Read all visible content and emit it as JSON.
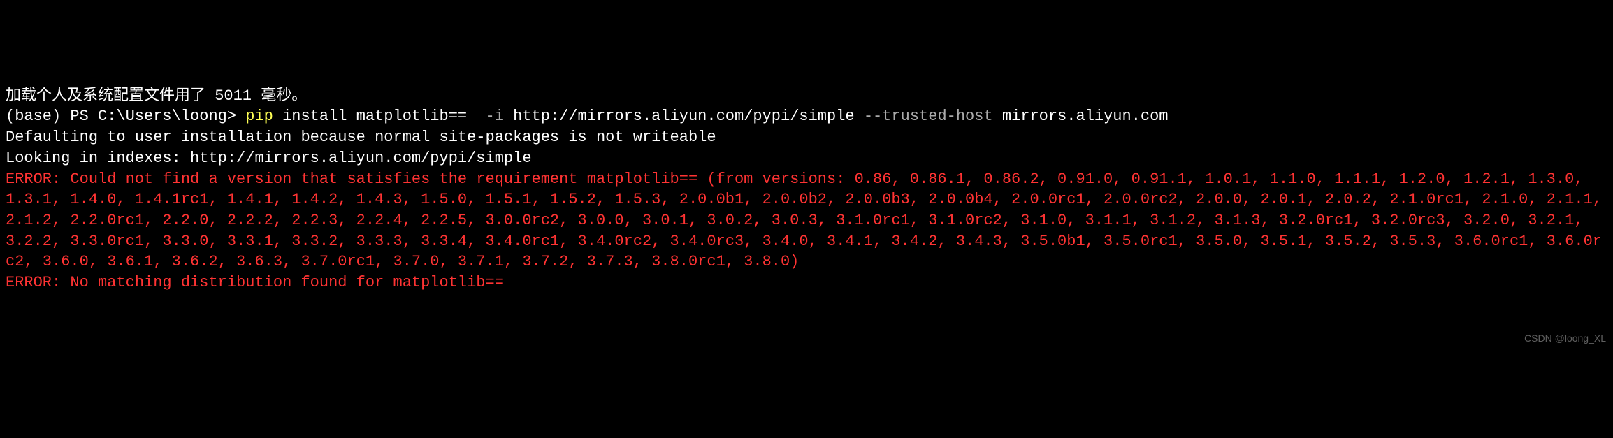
{
  "terminal": {
    "line1": "加载个人及系统配置文件用了 5011 毫秒。",
    "prompt_prefix": "(base) PS C:\\Users\\loong> ",
    "cmd_pip": "pip",
    "cmd_rest1": " install matplotlib==  ",
    "cmd_flag_i": "-i",
    "cmd_url": " http://mirrors.aliyun.com/pypi/simple ",
    "cmd_flag_th": "--trusted-host",
    "cmd_host": " mirrors.aliyun.com",
    "line_default": "Defaulting to user installation because normal site-packages is not writeable",
    "line_looking": "Looking in indexes: http://mirrors.aliyun.com/pypi/simple",
    "error_versions": "ERROR: Could not find a version that satisfies the requirement matplotlib== (from versions: 0.86, 0.86.1, 0.86.2, 0.91.0, 0.91.1, 1.0.1, 1.1.0, 1.1.1, 1.2.0, 1.2.1, 1.3.0, 1.3.1, 1.4.0, 1.4.1rc1, 1.4.1, 1.4.2, 1.4.3, 1.5.0, 1.5.1, 1.5.2, 1.5.3, 2.0.0b1, 2.0.0b2, 2.0.0b3, 2.0.0b4, 2.0.0rc1, 2.0.0rc2, 2.0.0, 2.0.1, 2.0.2, 2.1.0rc1, 2.1.0, 2.1.1, 2.1.2, 2.2.0rc1, 2.2.0, 2.2.2, 2.2.3, 2.2.4, 2.2.5, 3.0.0rc2, 3.0.0, 3.0.1, 3.0.2, 3.0.3, 3.1.0rc1, 3.1.0rc2, 3.1.0, 3.1.1, 3.1.2, 3.1.3, 3.2.0rc1, 3.2.0rc3, 3.2.0, 3.2.1, 3.2.2, 3.3.0rc1, 3.3.0, 3.3.1, 3.3.2, 3.3.3, 3.3.4, 3.4.0rc1, 3.4.0rc2, 3.4.0rc3, 3.4.0, 3.4.1, 3.4.2, 3.4.3, 3.5.0b1, 3.5.0rc1, 3.5.0, 3.5.1, 3.5.2, 3.5.3, 3.6.0rc1, 3.6.0rc2, 3.6.0, 3.6.1, 3.6.2, 3.6.3, 3.7.0rc1, 3.7.0, 3.7.1, 3.7.2, 3.7.3, 3.8.0rc1, 3.8.0)",
    "error_nomatch": "ERROR: No matching distribution found for matplotlib=="
  },
  "watermark": "CSDN @loong_XL"
}
